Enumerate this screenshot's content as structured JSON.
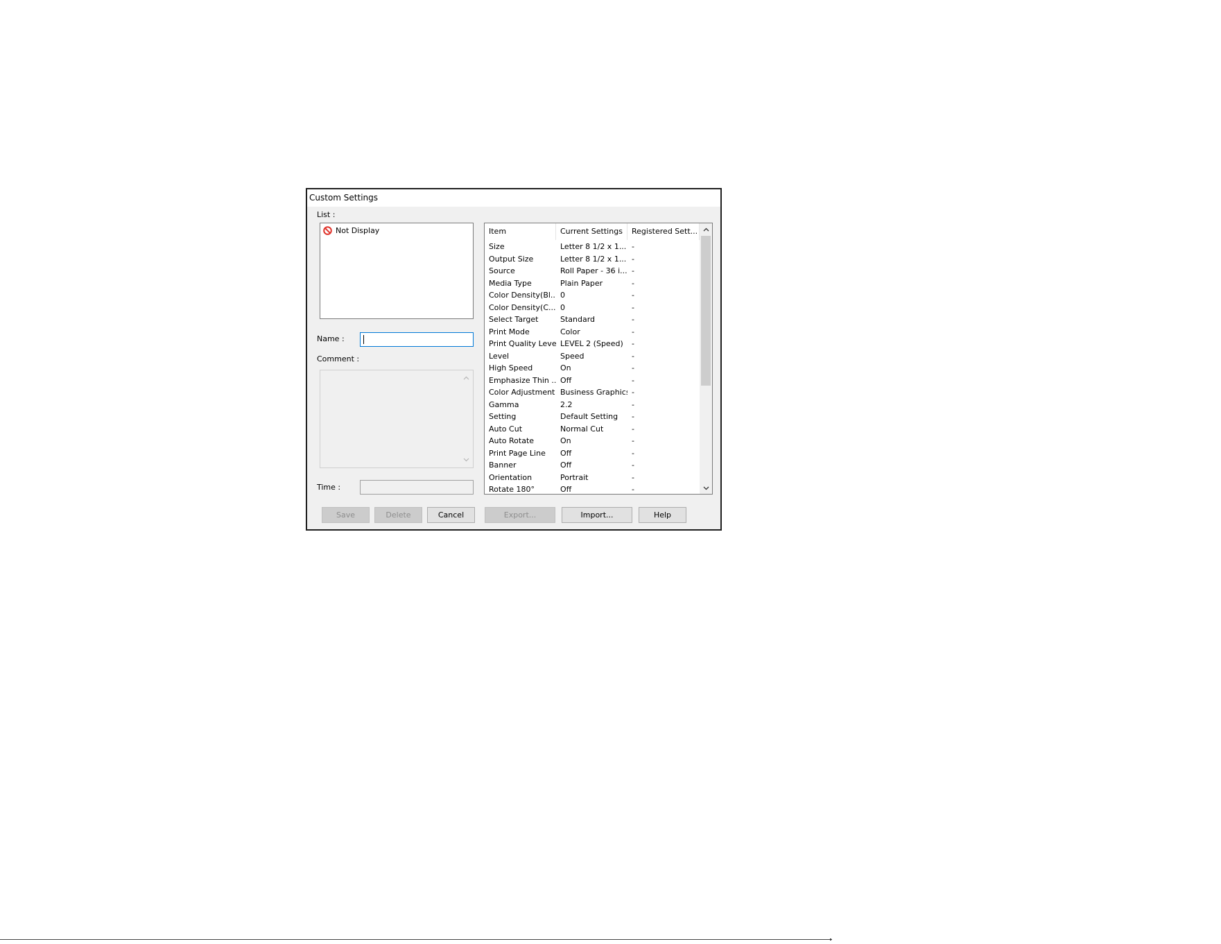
{
  "dialog": {
    "title": "Custom Settings",
    "list_label": "List :",
    "list_items": [
      {
        "label": "Not Display",
        "icon": "no-entry-icon"
      }
    ],
    "name_label": "Name :",
    "name_value": "",
    "comment_label": "Comment :",
    "time_label": "Time :",
    "table": {
      "headers": [
        "Item",
        "Current Settings",
        "Registered Sett..."
      ],
      "rows": [
        [
          "Size",
          "Letter 8 1/2 x 1...",
          "-"
        ],
        [
          "Output Size",
          "Letter 8 1/2 x 1...",
          "-"
        ],
        [
          "Source",
          "Roll Paper - 36 i...",
          "-"
        ],
        [
          "Media Type",
          "Plain Paper",
          "-"
        ],
        [
          "Color Density(Bl...",
          "0",
          "-"
        ],
        [
          "Color Density(C...",
          "0",
          "-"
        ],
        [
          "Select Target",
          "Standard",
          "-"
        ],
        [
          "Print Mode",
          "Color",
          "-"
        ],
        [
          "Print Quality Level",
          "LEVEL 2 (Speed)",
          "-"
        ],
        [
          "Level",
          "Speed",
          "-"
        ],
        [
          "High Speed",
          "On",
          "-"
        ],
        [
          "Emphasize Thin ...",
          "Off",
          "-"
        ],
        [
          "Color Adjustment",
          "Business Graphics",
          "-"
        ],
        [
          "Gamma",
          "2.2",
          "-"
        ],
        [
          "Setting",
          "Default Setting",
          "-"
        ],
        [
          "Auto Cut",
          "Normal Cut",
          "-"
        ],
        [
          "Auto Rotate",
          "On",
          "-"
        ],
        [
          "Print Page Line",
          "Off",
          "-"
        ],
        [
          "Banner",
          "Off",
          "-"
        ],
        [
          "Orientation",
          "Portrait",
          "-"
        ],
        [
          "Rotate 180°",
          "Off",
          "-"
        ]
      ]
    },
    "buttons": {
      "save": "Save",
      "delete": "Delete",
      "cancel": "Cancel",
      "export": "Export...",
      "import": "Import...",
      "help": "Help"
    },
    "colors": {
      "focus_border": "#0078d7",
      "no_entry_icon": "#e0342c"
    }
  }
}
